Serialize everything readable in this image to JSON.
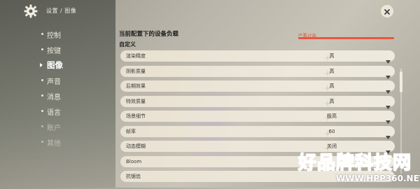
{
  "header": {
    "breadcrumb": "设置 / 图像"
  },
  "sidebar": {
    "items": [
      {
        "label": "控制",
        "state": "normal"
      },
      {
        "label": "按键",
        "state": "normal"
      },
      {
        "label": "图像",
        "state": "active"
      },
      {
        "label": "声音",
        "state": "normal"
      },
      {
        "label": "消息",
        "state": "normal"
      },
      {
        "label": "语言",
        "state": "normal"
      },
      {
        "label": "账户",
        "state": "faded"
      },
      {
        "label": "其他",
        "state": "faded"
      }
    ]
  },
  "main": {
    "section_title": "当前配置下的设备负载",
    "load": {
      "label": "严重过高",
      "level_fraction": 1.0,
      "color": "#e7573f"
    },
    "sub_label": "自定义",
    "settings": [
      {
        "label": "渲染精度",
        "value": "高"
      },
      {
        "label": "阴影质量",
        "value": "高"
      },
      {
        "label": "后期效果",
        "value": "高"
      },
      {
        "label": "特效质量",
        "value": "高"
      },
      {
        "label": "场景细节",
        "value": "极高"
      },
      {
        "label": "帧率",
        "value": "60"
      },
      {
        "label": "动态模糊",
        "value": "关闭"
      },
      {
        "label": "Bloom",
        "value": ""
      },
      {
        "label": "抗锯齿",
        "value": ""
      }
    ]
  },
  "watermark": {
    "main": "好品牌科技网",
    "url": "WWW.HPP360.NET"
  },
  "colors": {
    "accent": "#e7573f",
    "row_bg": "#ece5d5",
    "watermark": "#ff7a22"
  }
}
